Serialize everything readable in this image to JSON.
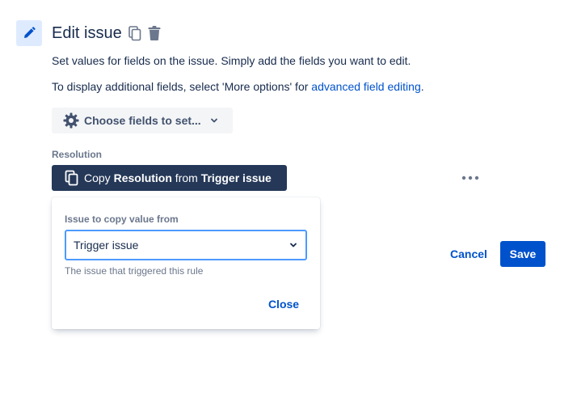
{
  "header": {
    "title": "Edit issue",
    "icons": [
      "pencil-icon",
      "copy-icon",
      "trash-icon"
    ]
  },
  "description": {
    "line1": "Set values for fields on the issue. Simply add the fields you want to edit.",
    "line2_prefix": "To display additional fields, select 'More options' for ",
    "line2_link": "advanced field editing",
    "line2_suffix": "."
  },
  "choose_fields": {
    "label": "Choose fields to set...",
    "icon": "gear-icon",
    "chevron": "chevron-down-icon"
  },
  "resolution": {
    "label": "Resolution",
    "copy_button": {
      "prefix": "Copy ",
      "field": "Resolution",
      "middle": " from ",
      "source": "Trigger issue"
    },
    "more_icon": "more-horizontal-icon"
  },
  "popup": {
    "label": "Issue to copy value from",
    "selected": "Trigger issue",
    "helper": "The issue that triggered this rule",
    "close_label": "Close"
  },
  "actions": {
    "cancel_label": "Cancel",
    "save_label": "Save"
  },
  "colors": {
    "primary": "#0052cc",
    "dark_button": "#253858",
    "focus_border": "#4c9aff",
    "icon_tile": "#deebff"
  }
}
